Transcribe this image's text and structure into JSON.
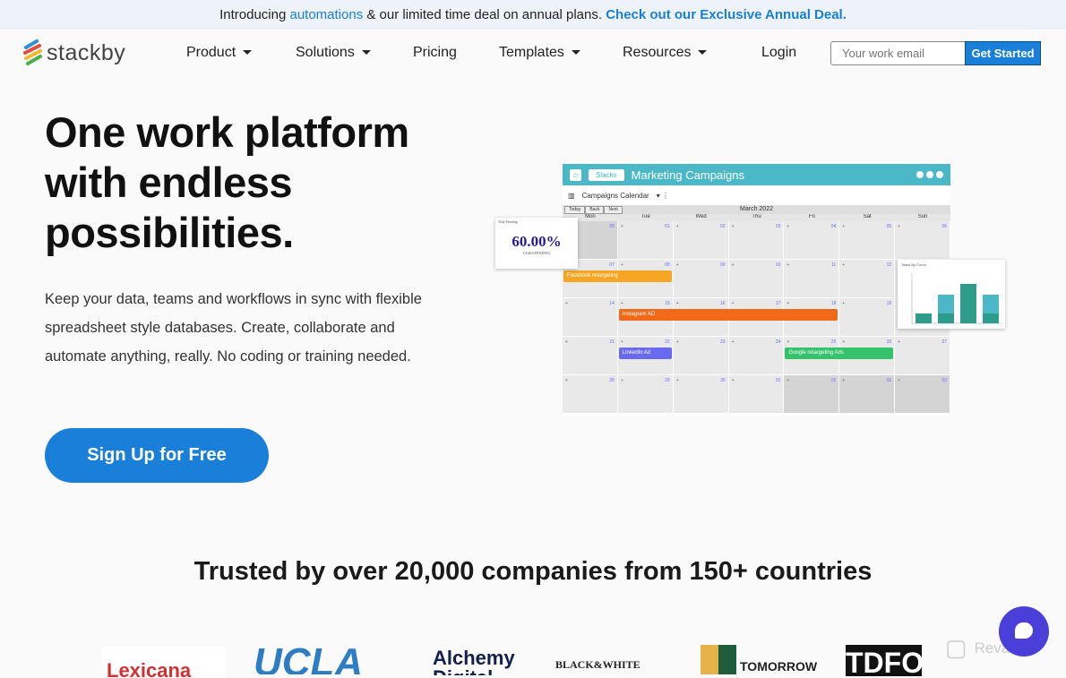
{
  "banner": {
    "pre": "Introducing ",
    "link": "automations",
    "mid": " & our limited time deal on annual plans. ",
    "cta": "Check out our Exclusive Annual Deal."
  },
  "nav": {
    "logo": "stackby",
    "items": [
      "Product",
      "Solutions",
      "Pricing",
      "Templates",
      "Resources"
    ],
    "login": "Login",
    "email_placeholder": "Your work email",
    "get_started": "Get Started"
  },
  "hero": {
    "title": "One work platform with endless possibilities.",
    "subtitle": "Keep your data, teams and workflows in sync with flexible spreadsheet style databases. Create, collaborate and automate anything, really. No coding or training needed.",
    "cta": "Sign Up for Free"
  },
  "mockup": {
    "stack": "Slacks",
    "title": "Marketing Campaigns",
    "view": "Campaigns Calendar",
    "nav_buttons": [
      "Today",
      "Back",
      "Next"
    ],
    "month": "March 2022",
    "days": [
      "Mon",
      "Tue",
      "Wed",
      "Thu",
      "Fri",
      "Sat",
      "Sun"
    ],
    "dates": [
      "28",
      "01",
      "02",
      "03",
      "04",
      "05",
      "06",
      "07",
      "08",
      "09",
      "10",
      "11",
      "12",
      "13",
      "14",
      "15",
      "16",
      "17",
      "18",
      "19",
      "20",
      "21",
      "22",
      "23",
      "24",
      "25",
      "26",
      "27",
      "28",
      "29",
      "30",
      "31",
      "01",
      "02",
      "03"
    ],
    "events": [
      {
        "label": "Facebook retargeting",
        "color": "#f5a623"
      },
      {
        "label": "Instagram AD",
        "color": "#f06a1a"
      },
      {
        "label": "LinkedIn Ad",
        "color": "#6a6af0"
      },
      {
        "label": "Google retargeting Ads",
        "color": "#34c36a"
      }
    ],
    "stat_card": {
      "header": "Task Pending",
      "value": "60.00%",
      "label": "TASKS PENDING"
    },
    "chart_card": {
      "header": "Tasks By Count",
      "colors": [
        "#2e9c8a",
        "#4bb8c8"
      ]
    }
  },
  "trusted": "Trusted by over 20,000 companies from 150+ countries",
  "logos": [
    "Lexicana",
    "UCLA",
    "Alchemy Digital Media",
    "BLACK&WHITE",
    "TOMORROW",
    "TDFO"
  ],
  "watermark": "Revain"
}
